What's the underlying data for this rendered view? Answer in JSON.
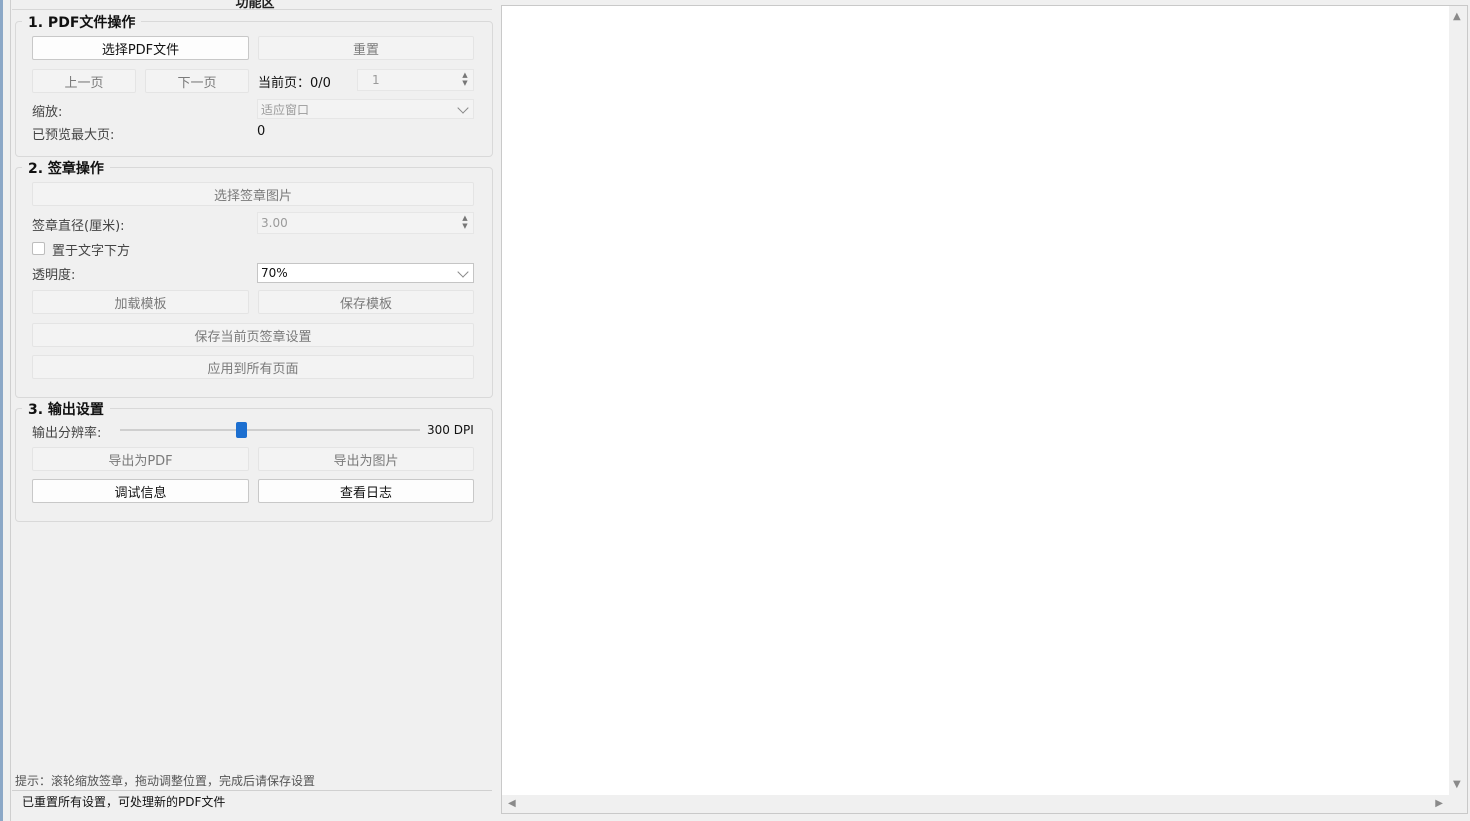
{
  "panel": {
    "title": "功能区"
  },
  "pdf_ops": {
    "title": "1. PDF文件操作",
    "select_pdf": "选择PDF文件",
    "reset": "重置",
    "prev_page": "上一页",
    "next_page": "下一页",
    "current_page_label": "当前页：0/0",
    "page_spin_value": "1",
    "zoom_label": "缩放:",
    "zoom_value": "适应窗口",
    "max_preview_label": "已预览最大页:",
    "max_preview_value": "0"
  },
  "seal_ops": {
    "title": "2. 签章操作",
    "select_seal_image": "选择签章图片",
    "diameter_label": "签章直径(厘米):",
    "diameter_value": "3.00",
    "below_text_label": "置于文字下方",
    "below_text_checked": false,
    "opacity_label": "透明度:",
    "opacity_value": "70%",
    "load_template": "加载模板",
    "save_template": "保存模板",
    "save_current_page": "保存当前页签章设置",
    "apply_all_pages": "应用到所有页面"
  },
  "output": {
    "title": "3. 输出设置",
    "resolution_label": "输出分辨率:",
    "resolution_value": "300 DPI",
    "resolution_slider_fraction": 0.4,
    "export_pdf": "导出为PDF",
    "export_image": "导出为图片",
    "debug_info": "调试信息",
    "view_log": "查看日志"
  },
  "hint": "提示：滚轮缩放签章，拖动调整位置，完成后请保存设置",
  "status": "已重置所有设置，可处理新的PDF文件"
}
